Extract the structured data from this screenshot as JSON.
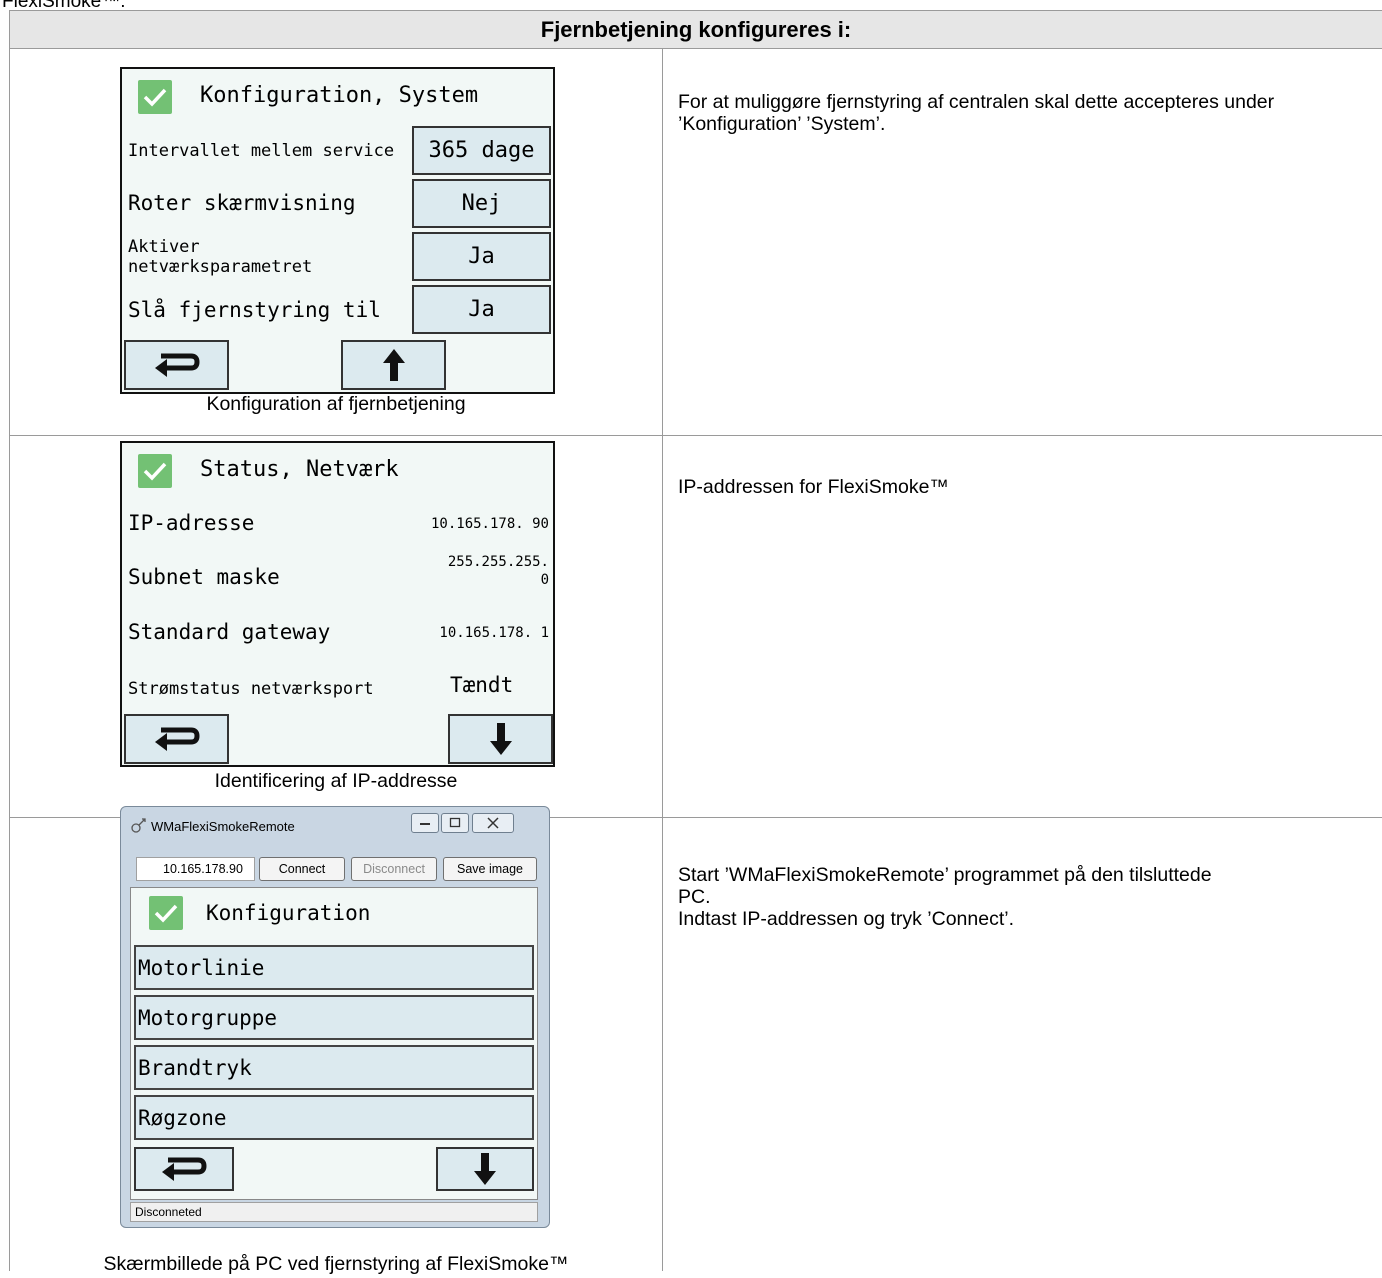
{
  "top_cut_text": "FlexiSmoke™:",
  "table": {
    "header": "Fjernbetjening konfigureres i:",
    "rows": [
      {
        "caption": "Konfiguration af fjernbetjening",
        "description": "For at muliggøre fjernstyring af centralen skal dette accepteres under ’Konfiguration’ ’System’."
      },
      {
        "caption": "Identificering af IP-addresse",
        "description": "IP-addressen for FlexiSmoke™"
      },
      {
        "caption": "Skærmbillede på PC ved fjernstyring af FlexiSmoke™",
        "description_lines": [
          "Start ’WMaFlexiSmokeRemote’ programmet på den tilsluttede",
          "PC.",
          "Indtast IP-addressen og tryk ’Connect’."
        ]
      }
    ]
  },
  "screen_system": {
    "title": "Konfiguration, System",
    "rows": [
      {
        "label": "Intervallet mellem service",
        "value": "365 dage"
      },
      {
        "label": "Roter skærmvisning",
        "value": "Nej"
      },
      {
        "label_line1": "Aktiver",
        "label_line2": "netværksparametret",
        "value": "Ja"
      },
      {
        "label": "Slå fjernstyring til",
        "value": "Ja"
      }
    ]
  },
  "screen_network": {
    "title": "Status, Netværk",
    "rows": [
      {
        "label": "IP-adresse",
        "value": "10.165.178. 90"
      },
      {
        "label": "Subnet maske",
        "value_line1": "255.255.255.",
        "value_line2": "0"
      },
      {
        "label": "Standard gateway",
        "value": "10.165.178. 1"
      },
      {
        "label": "Strømstatus netværksport",
        "value": "Tændt"
      }
    ]
  },
  "remote_app": {
    "window_title": "WMaFlexiSmokeRemote",
    "ip_value": "10.165.178.90",
    "connect_label": "Connect",
    "disconnect_label": "Disconnect",
    "save_label": "Save image",
    "screen_title": "Konfiguration",
    "menu_items": [
      "Motorlinie",
      "Motorgruppe",
      "Brandtryk",
      "Røgzone"
    ],
    "status_text": "Disconneted"
  },
  "colors": {
    "check_green": "#73c174",
    "button_fill": "#dceaef",
    "screen_bg": "#f2f8f6",
    "header_bg": "#e6e6e6"
  }
}
